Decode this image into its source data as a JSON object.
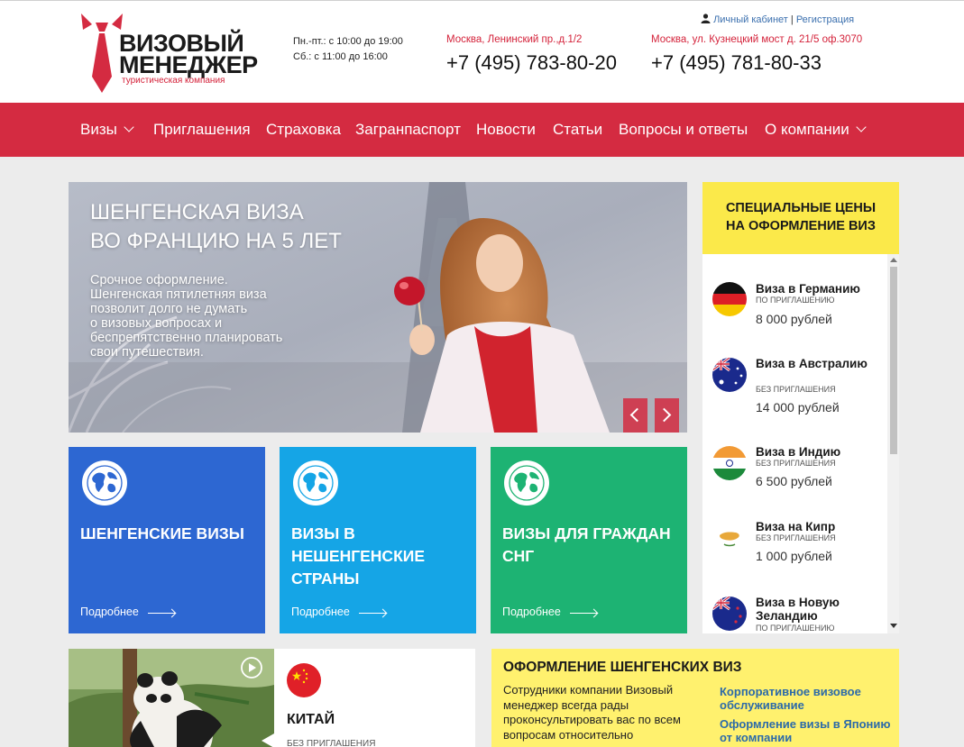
{
  "header": {
    "logo_line1": "ВИЗОВЫЙ",
    "logo_line2": "МЕНЕДЖЕР",
    "logo_sub": "туристическая компания",
    "hours_weekdays": "Пн.-пт.: с 10:00 до 19:00",
    "hours_saturday": "Сб.: с 11:00 до 16:00",
    "office1_address": "Москва, Ленинский пр.,д.1/2",
    "office1_phone": "+7 (495) 783-80-20",
    "office2_address": "Москва, ул. Кузнецкий мост д. 21/5 оф.3070",
    "office2_phone": "+7 (495) 781-80-33",
    "account_link": "Личный кабинет",
    "account_sep": "|",
    "register_link": "Регистрация"
  },
  "nav": {
    "items": [
      {
        "label": "Визы",
        "dropdown": true
      },
      {
        "label": "Приглашения"
      },
      {
        "label": "Страховка"
      },
      {
        "label": "Загранпаспорт"
      },
      {
        "label": "Новости"
      },
      {
        "label": "Статьи"
      },
      {
        "label": "Вопросы и ответы"
      },
      {
        "label": "О компании",
        "dropdown": true
      }
    ]
  },
  "slider": {
    "title_line1": "ШЕНГЕНСКАЯ ВИЗА",
    "title_line2": "ВО ФРАНЦИЮ НА 5 ЛЕТ",
    "desc_lines": [
      "Срочное оформление.",
      "Шенгенская пятилетняя виза",
      "позволит долго не думать",
      "о визовых вопросах и",
      "беспрепятственно планировать",
      "свои путешествия."
    ],
    "prev_icon": "chevron-left-icon",
    "next_icon": "chevron-right-icon"
  },
  "tiles": [
    {
      "title": "ШЕНГЕНСКИЕ ВИЗЫ",
      "more": "Подробнее",
      "color": "#2d67d2",
      "icon": "globe-icon"
    },
    {
      "title": "ВИЗЫ В НЕШЕНГЕНСКИЕ СТРАНЫ",
      "more": "Подробнее",
      "color": "#15a5e6",
      "icon": "globe-icon"
    },
    {
      "title": "ВИЗЫ ДЛЯ ГРАЖДАН СНГ",
      "more": "Подробнее",
      "color": "#1db373",
      "icon": "globe-icon"
    }
  ],
  "special": {
    "title_line1": "СПЕЦИАЛЬНЫЕ ЦЕНЫ",
    "title_line2": "НА ОФОРМЛЕНИЕ ВИЗ",
    "color": "#fbe94a",
    "items": [
      {
        "name": "Визa в Германию",
        "condition": "ПО ПРИГЛАШЕНИЮ",
        "price": "8 000 рублей",
        "flag": "germany-flag-icon"
      },
      {
        "name": "Виза в Австралию",
        "condition": "БЕЗ ПРИГЛАШЕНИЯ",
        "price": "14 000 рублей",
        "flag": "australia-flag-icon"
      },
      {
        "name": "Виза в Индию",
        "condition": "БЕЗ ПРИГЛАШЕНИЯ",
        "price": "6 500 рублей",
        "flag": "india-flag-icon"
      },
      {
        "name": "Виза на Кипр",
        "condition": "БЕЗ ПРИГЛАШЕНИЯ",
        "price": "1 000 рублей",
        "flag": "cyprus-flag-icon"
      },
      {
        "name": "Виза в Новую Зеландию",
        "condition": "ПО ПРИГЛАШЕНИЮ",
        "price": "",
        "flag": "new-zealand-flag-icon"
      }
    ]
  },
  "china": {
    "name": "КИТАЙ",
    "condition": "БЕЗ ПРИГЛАШЕНИЯ",
    "flag": "china-flag-icon",
    "play_icon": "play-icon"
  },
  "schengen_box": {
    "title": "ОФОРМЛЕНИЕ ШЕНГЕНСКИХ ВИЗ",
    "text": "Сотрудники компании Визовый менеджер всегда рады проконсультировать вас по всем вопросам относительно",
    "links": [
      "Корпоративное визовое обслуживание",
      "Оформление визы в Японию от компании"
    ],
    "color": "#fff16e"
  },
  "colors": {
    "brand_red": "#d42b41",
    "link_blue": "#2c6aa9",
    "page_bg": "#ececec"
  }
}
